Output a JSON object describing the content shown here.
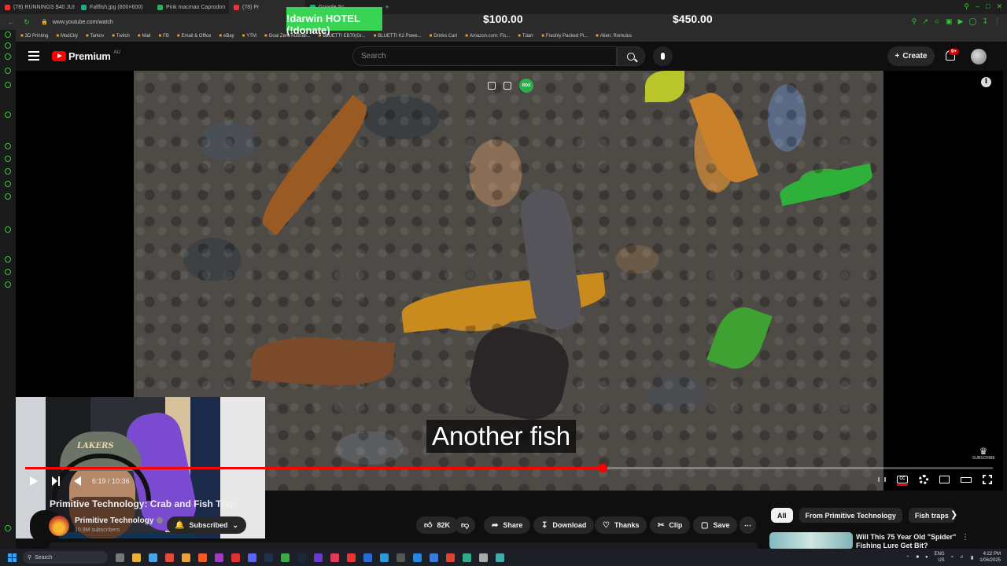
{
  "browser": {
    "tabs": [
      {
        "label": "(78) RUNNINGS $40 JUI",
        "active": false
      },
      {
        "label": "Fallfish.jpg (800×600)",
        "active": false
      },
      {
        "label": "Pink macmao Caprodon",
        "active": false
      },
      {
        "label": "(78) Pr",
        "active": true
      },
      {
        "label": "Google Sc",
        "active": false
      }
    ],
    "url": "www.youtube.com/watch",
    "bookmarks": [
      "3D Printing",
      "ModCity",
      "Tarkov",
      "Twitch",
      "Mail",
      "FB",
      "Email & Office",
      "eBay",
      "YTM",
      "Goal Zero Australi...",
      "BLUETTI EB70(Gr...",
      "BLUETTI K2 Powe...",
      "Drinks Cart",
      "Amazon.com: Fis...",
      "Tdarr",
      "Freshly Packed Pi...",
      "Alien: Romulus"
    ]
  },
  "overlay": {
    "donate": "!darwin HOTEL (!donate)",
    "goal_current": "$100.00",
    "goal_target": "$450.00"
  },
  "header": {
    "logo": "Premium",
    "region": "AU",
    "search_placeholder": "Search",
    "create_label": "Create",
    "notifications_badge": "9+"
  },
  "player": {
    "caption": "Another fish",
    "current_time": "6:19",
    "duration": "10:36",
    "progress": 0.597,
    "watermark": "SUBSCRIBE",
    "webcam_hat_logo": "LAKERS"
  },
  "video": {
    "title": "Primitive Technology: Crab and Fish Trap",
    "channel": "Primitive Technology",
    "subscribers": "10.9M subscribers",
    "subscribed_label": "Subscribed",
    "likes": "82K",
    "share_label": "Share",
    "download_label": "Download",
    "thanks_label": "Thanks",
    "clip_label": "Clip",
    "save_label": "Save"
  },
  "sidebar_right": {
    "chips": [
      {
        "label": "All",
        "active": true
      },
      {
        "label": "From Primitive Technology",
        "active": false
      },
      {
        "label": "Fish traps",
        "active": false
      }
    ],
    "recommended_title": "Will This 75 Year Old \"Spider\" Fishing Lure Get Bit?"
  },
  "taskbar": {
    "search_label": "Search",
    "lang": "ENG",
    "lang_region": "US",
    "time": "4:22 PM",
    "date": "1/06/2025"
  },
  "colors": {
    "youtube_red": "#ff0000",
    "donate_green": "#3ad455",
    "browser_accent": "#33cc33"
  }
}
